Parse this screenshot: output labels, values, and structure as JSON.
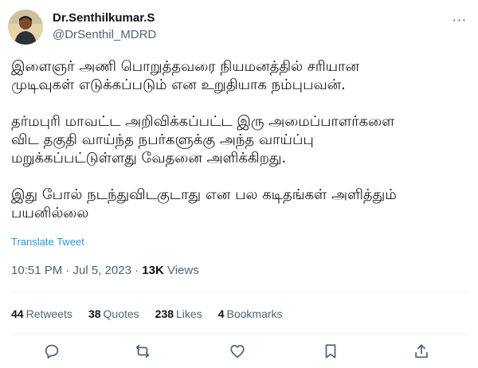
{
  "author": {
    "display_name": "Dr.Senthilkumar.S",
    "handle": "@DrSenthil_MDRD"
  },
  "more_menu": "···",
  "tweet": {
    "paragraphs": [
      "இளைஞர் அணி பொறுத்தவரை நியமனத்தில் சரியான\nமுடிவுகள் எடுக்கப்படும் என உறுதியாக நம்புபவன்.",
      "தர்மபுரி மாவட்ட அறிவிக்கப்பட்ட இரு அமைப்பாளர்களை\nவிட தகுதி வாய்ந்த நபர்களுக்கு அந்த வாய்ப்பு\nமறுக்கப்பட்டுள்ளது வேதனை அளிக்கிறது.",
      "இது போல் நடந்துவிடகுடாது என பல கடிதங்கள் அளித்தும்\nபயனில்லை"
    ],
    "translate_label": "Translate Tweet"
  },
  "meta": {
    "timestamp": "10:51 PM · Jul 5, 2023",
    "separator": " · ",
    "views_count": "13K",
    "views_label": " Views"
  },
  "stats": {
    "retweets_count": "44",
    "retweets_label": "Retweets",
    "quotes_count": "38",
    "quotes_label": "Quotes",
    "likes_count": "238",
    "likes_label": "Likes",
    "bookmarks_count": "4",
    "bookmarks_label": "Bookmarks"
  },
  "actions": [
    "reply-icon",
    "retweet-icon",
    "like-icon",
    "bookmark-icon",
    "share-icon"
  ],
  "colors": {
    "link": "#1d9bf0",
    "secondary_text": "#536471",
    "primary_text": "#0f1419",
    "divider": "#eff3f4"
  }
}
